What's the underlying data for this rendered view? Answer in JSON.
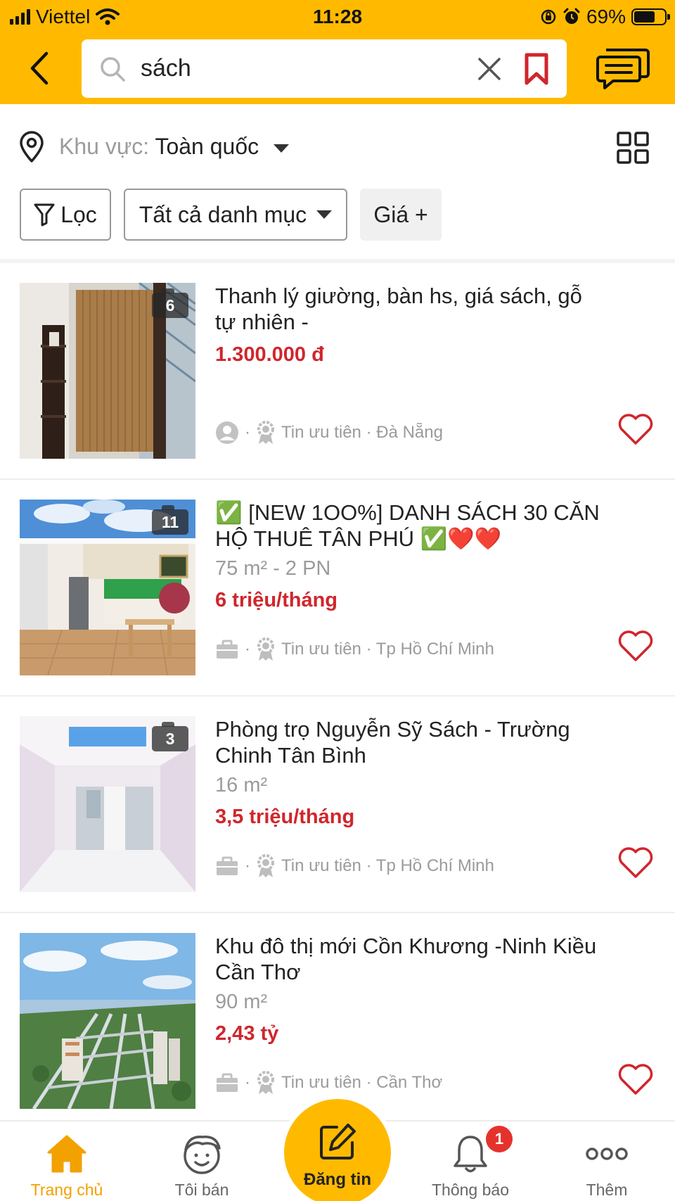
{
  "status_bar": {
    "carrier": "Viettel",
    "time": "11:28",
    "battery": "69%",
    "battery_level": 0.69
  },
  "search": {
    "query": "sách",
    "back_icon": "chevron-left-icon",
    "search_icon": "magnifier-icon",
    "clear_icon": "close-icon",
    "bookmark_icon": "bookmark-icon",
    "chat_icon": "chat-icon"
  },
  "location_filter": {
    "label": "Khu vực:",
    "value": "Toàn quốc"
  },
  "filters": {
    "filter_label": "Lọc",
    "category_label": "Tất cả danh mục",
    "price_label": "Giá +"
  },
  "listings": [
    {
      "title_line1": "Thanh lý giường, bàn hs, giá sách, gỗ",
      "title_line2": "tự nhiên -",
      "detail": "",
      "price": "1.300.000 đ",
      "photo_count": "6",
      "seller_icon": "user-icon",
      "meta": "Tin ưu tiên · Đà Nẵng"
    },
    {
      "title_line1": "✅ [NEW 1OO%] DANH SÁCH 30 CĂN",
      "title_line2": "HỘ THUÊ TÂN PHÚ ✅❤️❤️",
      "detail": "75 m² - 2 PN",
      "price": "6 triệu/tháng",
      "photo_count": "11",
      "seller_icon": "briefcase-icon",
      "meta": "Tin ưu tiên · Tp Hồ Chí Minh"
    },
    {
      "title_line1": "Phòng trọ Nguyễn Sỹ Sách - Trường",
      "title_line2": "Chinh Tân Bình",
      "detail": "16 m²",
      "price": "3,5 triệu/tháng",
      "photo_count": "3",
      "seller_icon": "briefcase-icon",
      "meta": "Tin ưu tiên · Tp Hồ Chí Minh"
    },
    {
      "title_line1": "Khu đô thị mới Cồn Khương -Ninh Kiều",
      "title_line2": "Cần Thơ",
      "detail": "90 m²",
      "price": "2,43 tỷ",
      "photo_count": "",
      "seller_icon": "briefcase-icon",
      "meta": "Tin ưu tiên · Cần Thơ"
    }
  ],
  "bottom_nav": {
    "home": "Trang chủ",
    "my_sales": "Tôi bán",
    "post": "Đăng tin",
    "notifications": "Thông báo",
    "notification_count": "1",
    "more": "Thêm"
  },
  "colors": {
    "brand_yellow": "#ffba00",
    "price_red": "#d0262c",
    "active_orange": "#f2a100"
  }
}
